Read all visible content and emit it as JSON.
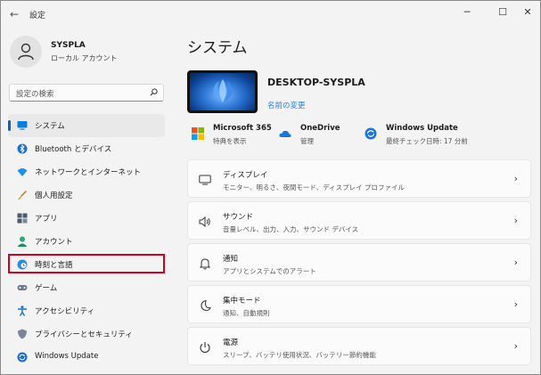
{
  "window": {
    "title": "設定",
    "back_glyph": "←",
    "minimize_glyph": "─",
    "maximize_glyph": "☐",
    "close_glyph": "✕"
  },
  "profile": {
    "name": "SYSPLA",
    "type": "ローカル アカウント"
  },
  "search": {
    "placeholder": "設定の検索"
  },
  "sidebar": {
    "items": [
      {
        "label": "システム",
        "icon": "monitor-icon",
        "active": true
      },
      {
        "label": "Bluetooth とデバイス",
        "icon": "bluetooth-icon"
      },
      {
        "label": "ネットワークとインターネット",
        "icon": "wifi-icon"
      },
      {
        "label": "個人用設定",
        "icon": "brush-icon"
      },
      {
        "label": "アプリ",
        "icon": "apps-icon"
      },
      {
        "label": "アカウント",
        "icon": "person-icon"
      },
      {
        "label": "時刻と言語",
        "icon": "globe-clock-icon",
        "highlighted": true
      },
      {
        "label": "ゲーム",
        "icon": "gamepad-icon"
      },
      {
        "label": "アクセシビリティ",
        "icon": "accessibility-icon"
      },
      {
        "label": "プライバシーとセキュリティ",
        "icon": "shield-icon"
      },
      {
        "label": "Windows Update",
        "icon": "update-icon"
      }
    ]
  },
  "main": {
    "title": "システム",
    "device_name": "DESKTOP-SYSPLA",
    "rename_link": "名前の変更",
    "quick": [
      {
        "title": "Microsoft 365",
        "sub": "特典を表示",
        "icon": "microsoft-logo-icon"
      },
      {
        "title": "OneDrive",
        "sub": "管理",
        "icon": "onedrive-cloud-icon"
      },
      {
        "title": "Windows Update",
        "sub": "最終チェック日時: 17 分前",
        "icon": "windows-update-icon"
      }
    ],
    "cards": [
      {
        "title": "ディスプレイ",
        "sub": "モニター、明るさ、夜間モード、ディスプレイ プロファイル",
        "icon": "display-icon"
      },
      {
        "title": "サウンド",
        "sub": "音量レベル、出力、入力、サウンド デバイス",
        "icon": "speaker-icon"
      },
      {
        "title": "通知",
        "sub": "アプリとシステムでのアラート",
        "icon": "bell-icon"
      },
      {
        "title": "集中モード",
        "sub": "通知、自動規則",
        "icon": "moon-icon"
      },
      {
        "title": "電源",
        "sub": "スリープ、バッテリ使用状況、バッテリー節約機能",
        "icon": "power-icon"
      }
    ],
    "chevron": "›"
  },
  "colors": {
    "accent": "#0067c0",
    "link": "#2a7de1",
    "highlight_border": "#d0021b"
  }
}
